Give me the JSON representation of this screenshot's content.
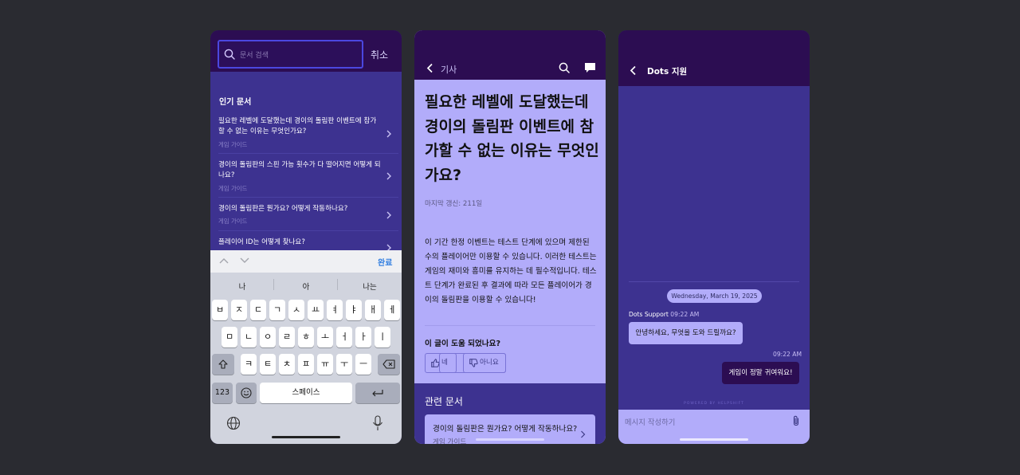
{
  "search_screen": {
    "search_placeholder": "문서 검색",
    "cancel_label": "취소",
    "popular_title": "인기 문서",
    "articles": [
      {
        "title": "필요한 레벨에 도달했는데 경이의 돌림판 이벤트에 참가할 수 없는 이유는 무엇인가요?",
        "category": "게임 가이드"
      },
      {
        "title": "경이의 돌림판의 스핀 가능 횟수가 다 떨어지면 어떻게 되나요?",
        "category": "게임 가이드"
      },
      {
        "title": "경이의 돌림판은 뭔가요? 어떻게 작동하나요?",
        "category": "게임 가이드"
      },
      {
        "title": "플레이어 ID는 어떻게 찾나요?",
        "category": ""
      }
    ],
    "keyboard": {
      "done_label": "완료",
      "suggestions": [
        "나",
        "아",
        "나는"
      ],
      "row1": [
        "ㅂ",
        "ㅈ",
        "ㄷ",
        "ㄱ",
        "ㅅ",
        "ㅛ",
        "ㅕ",
        "ㅑ",
        "ㅐ",
        "ㅔ"
      ],
      "row2": [
        "ㅁ",
        "ㄴ",
        "ㅇ",
        "ㄹ",
        "ㅎ",
        "ㅗ",
        "ㅓ",
        "ㅏ",
        "ㅣ"
      ],
      "row3": [
        "ㅋ",
        "ㅌ",
        "ㅊ",
        "ㅍ",
        "ㅠ",
        "ㅜ",
        "ㅡ"
      ],
      "numbers_label": "123",
      "space_label": "스페이스"
    }
  },
  "article_screen": {
    "header_label": "기사",
    "title": "필요한 레벨에 도달했는데 경이의 돌림판 이벤트에 참가할 수 없는 이유는 무엇인가요?",
    "meta": "마지막 갱신: 211일",
    "body": "이 기간 한정 이벤트는 테스트 단계에 있으며 제한된 수의 플레이어만 이용할 수 있습니다. 이러한 테스트는 게임의 재미와 흥미를 유지하는 데 필수적입니다. 테스트 단계가 완료된 후 결과에 따라 모든 플레이어가 경이의 돌림판을 이용할 수 있습니다!",
    "helpful_question": "이 글이 도움 되었나요?",
    "yes_label": "네",
    "no_label": "아니요",
    "related_title": "관련 문서",
    "related": [
      {
        "title": "경이의 돌림판은 뭔가요? 어떻게 작동하나요?",
        "category": "게임 가이드"
      }
    ]
  },
  "chat_screen": {
    "title": "Dots 지원",
    "date_divider": "Wednesday, March 19, 2025",
    "agent_name": "Dots Support",
    "agent_time": "09:22 AM",
    "agent_message": "안녕하세요, 무엇을 도와 드릴까요?",
    "user_time": "09:22 AM",
    "user_message": "게임이 정말 귀여워요!",
    "powered_by": "POWERED BY HELPSHIFT",
    "composer_placeholder": "메시지 작성하기"
  },
  "colors": {
    "background": "#2a2b31",
    "header": "#2c0d52",
    "content": "#3d3290",
    "lavender": "#b2acfa",
    "link_blue": "#2f7de0"
  }
}
